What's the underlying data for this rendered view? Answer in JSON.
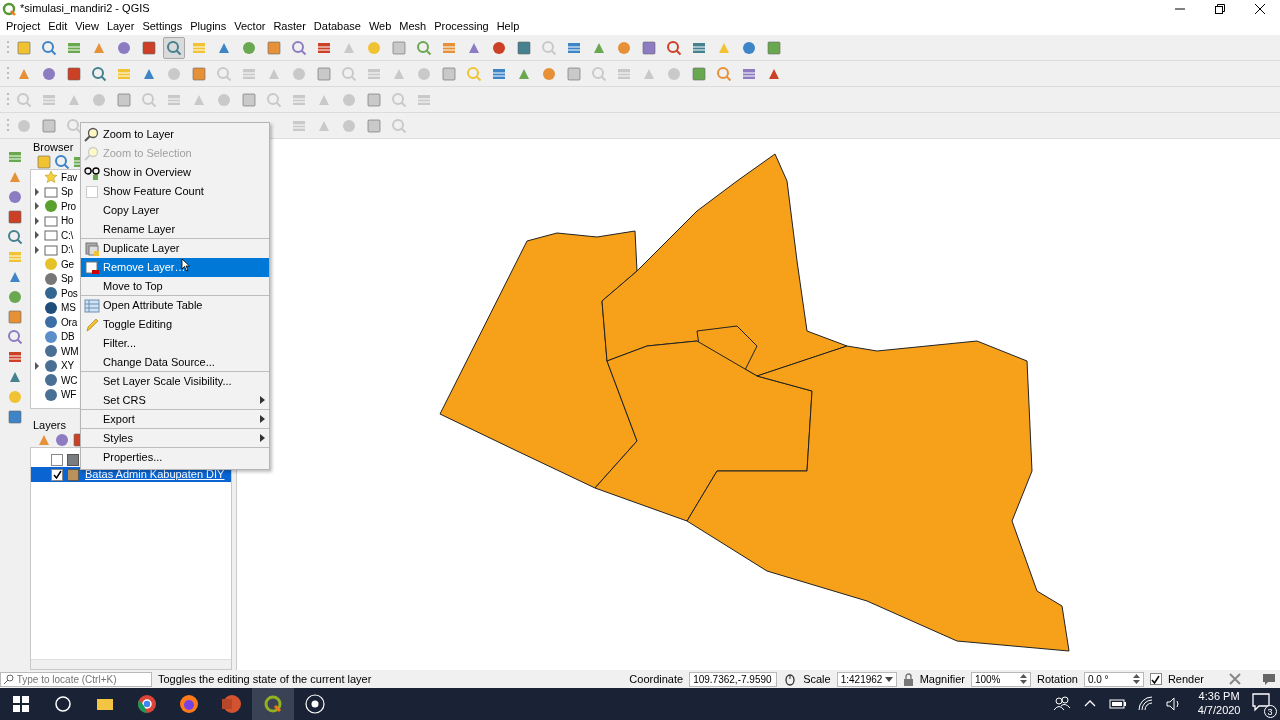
{
  "window": {
    "title": "*simulasi_mandiri2 - QGIS"
  },
  "menu_bar": [
    "Project",
    "Edit",
    "View",
    "Layer",
    "Settings",
    "Plugins",
    "Vector",
    "Raster",
    "Database",
    "Web",
    "Mesh",
    "Processing",
    "Help"
  ],
  "toolbars": [
    [
      {
        "disabled": false,
        "on": false
      },
      {
        "disabled": false,
        "on": false
      },
      {
        "disabled": false,
        "on": false
      },
      {
        "disabled": false,
        "on": false
      },
      {
        "disabled": false,
        "on": false
      },
      {
        "disabled": false,
        "on": false
      },
      {
        "disabled": false,
        "on": true
      },
      {
        "disabled": false,
        "on": false
      },
      {
        "disabled": false,
        "on": false
      },
      {
        "disabled": false,
        "on": false
      },
      {
        "disabled": false,
        "on": false
      },
      {
        "disabled": false,
        "on": false
      },
      {
        "disabled": false,
        "on": false
      },
      {
        "disabled": true,
        "on": false
      },
      {
        "disabled": false,
        "on": false
      },
      {
        "disabled": true,
        "on": false
      },
      {
        "disabled": false,
        "on": false
      },
      {
        "disabled": false,
        "on": false
      },
      {
        "disabled": false,
        "on": false
      },
      {
        "disabled": false,
        "on": false
      },
      {
        "disabled": false,
        "on": false
      },
      {
        "disabled": true,
        "on": false
      },
      {
        "disabled": false,
        "on": false
      },
      {
        "disabled": false,
        "on": false
      },
      {
        "disabled": false,
        "on": false
      },
      {
        "disabled": false,
        "on": false
      },
      {
        "disabled": false,
        "on": false
      },
      {
        "disabled": false,
        "on": false
      },
      {
        "disabled": false,
        "on": false
      },
      {
        "disabled": false,
        "on": false
      },
      {
        "disabled": false,
        "on": false
      }
    ],
    [
      {
        "disabled": false,
        "on": false
      },
      {
        "disabled": false,
        "on": false
      },
      {
        "disabled": false,
        "on": false
      },
      {
        "disabled": false,
        "on": false
      },
      {
        "disabled": false,
        "on": false
      },
      {
        "disabled": false,
        "on": false
      },
      {
        "disabled": true,
        "on": false
      },
      {
        "disabled": false,
        "on": false
      },
      {
        "disabled": true,
        "on": false
      },
      {
        "disabled": true,
        "on": false
      },
      {
        "disabled": true,
        "on": false
      },
      {
        "disabled": true,
        "on": false
      },
      {
        "disabled": true,
        "on": false
      },
      {
        "disabled": true,
        "on": false
      },
      {
        "disabled": true,
        "on": false
      },
      {
        "disabled": true,
        "on": false
      },
      {
        "disabled": true,
        "on": false
      },
      {
        "disabled": true,
        "on": false
      },
      {
        "disabled": false,
        "on": false
      },
      {
        "disabled": false,
        "on": false
      },
      {
        "disabled": false,
        "on": false
      },
      {
        "disabled": false,
        "on": false
      },
      {
        "disabled": true,
        "on": false
      },
      {
        "disabled": true,
        "on": false
      },
      {
        "disabled": true,
        "on": false
      },
      {
        "disabled": true,
        "on": false
      },
      {
        "disabled": true,
        "on": false
      },
      {
        "disabled": false,
        "on": false
      },
      {
        "disabled": false,
        "on": false
      },
      {
        "disabled": false,
        "on": false
      },
      {
        "disabled": false,
        "on": false
      }
    ],
    [
      {
        "disabled": true,
        "on": false
      },
      {
        "disabled": true,
        "on": false
      },
      {
        "disabled": true,
        "on": false
      },
      {
        "disabled": true,
        "on": false
      },
      {
        "disabled": true,
        "on": false
      },
      {
        "disabled": true,
        "on": false
      },
      {
        "disabled": true,
        "on": false
      },
      {
        "disabled": true,
        "on": false
      },
      {
        "disabled": true,
        "on": false
      },
      {
        "disabled": true,
        "on": false
      },
      {
        "disabled": true,
        "on": false
      },
      {
        "disabled": true,
        "on": false
      },
      {
        "disabled": true,
        "on": false
      },
      {
        "disabled": true,
        "on": false
      },
      {
        "disabled": true,
        "on": false
      },
      {
        "disabled": true,
        "on": false
      },
      {
        "disabled": true,
        "on": false
      }
    ],
    [
      {
        "disabled": true,
        "on": false
      },
      {
        "disabled": true,
        "on": false
      },
      {
        "disabled": true,
        "on": false
      },
      {
        "disabled": true,
        "on": false
      },
      {
        "disabled": true,
        "on": false
      },
      {
        "disabled": true,
        "on": false
      },
      {
        "disabled": true,
        "on": false
      },
      {
        "disabled": true,
        "on": false
      }
    ]
  ],
  "browser_panel": {
    "title": "Browser",
    "items": [
      {
        "label": "Fav",
        "expandable": false,
        "kind": "star"
      },
      {
        "label": "Sp",
        "expandable": true,
        "kind": "bookmark"
      },
      {
        "label": "Pro",
        "expandable": true,
        "kind": "project"
      },
      {
        "label": "Ho",
        "expandable": true,
        "kind": "home"
      },
      {
        "label": "C:\\",
        "expandable": true,
        "kind": "folder"
      },
      {
        "label": "D:\\",
        "expandable": true,
        "kind": "folder"
      },
      {
        "label": "Ge",
        "expandable": false,
        "kind": "package"
      },
      {
        "label": "Sp",
        "expandable": false,
        "kind": "feather"
      },
      {
        "label": "Pos",
        "expandable": false,
        "kind": "elephant"
      },
      {
        "label": "MS",
        "expandable": false,
        "kind": "fish"
      },
      {
        "label": "Ora",
        "expandable": false,
        "kind": "disc"
      },
      {
        "label": "DB",
        "expandable": false,
        "kind": "db2"
      },
      {
        "label": "WM",
        "expandable": false,
        "kind": "globe"
      },
      {
        "label": "XY",
        "expandable": true,
        "kind": "globe"
      },
      {
        "label": "WC",
        "expandable": false,
        "kind": "globe"
      },
      {
        "label": "WF",
        "expandable": false,
        "kind": "globe"
      }
    ]
  },
  "layers_panel": {
    "title": "Layers",
    "layers": [
      {
        "checked": false,
        "selected": false,
        "color": "#7a7d80"
      },
      {
        "label": "Batas Admin Kabupaten DIY",
        "checked": true,
        "selected": true,
        "color": "#b8925a"
      }
    ]
  },
  "context_menu": [
    {
      "label": "Zoom to Layer",
      "kind": "zoom",
      "disabled": false,
      "selected": false,
      "submenu": false,
      "separator_after": false
    },
    {
      "label": "Zoom to Selection",
      "kind": "zoom",
      "disabled": true,
      "selected": false,
      "submenu": false,
      "separator_after": false
    },
    {
      "label": "Show in Overview",
      "kind": "glasses",
      "disabled": false,
      "selected": false,
      "submenu": false,
      "separator_after": false
    },
    {
      "label": "Show Feature Count",
      "kind": "checkbox",
      "checked": false,
      "disabled": false,
      "selected": false,
      "submenu": false,
      "separator_after": false
    },
    {
      "label": "Copy Layer",
      "kind": "plain",
      "disabled": false,
      "selected": false,
      "submenu": false,
      "separator_after": false
    },
    {
      "label": "Rename Layer",
      "kind": "plain",
      "disabled": false,
      "selected": false,
      "submenu": false,
      "separator_after": true
    },
    {
      "label": "Duplicate Layer",
      "kind": "duplicate",
      "disabled": false,
      "selected": false,
      "submenu": false,
      "separator_after": false
    },
    {
      "label": "Remove Layer…",
      "kind": "remove",
      "disabled": false,
      "selected": true,
      "submenu": false,
      "separator_after": false
    },
    {
      "label": "Move to Top",
      "kind": "plain",
      "disabled": false,
      "selected": false,
      "submenu": false,
      "separator_after": true
    },
    {
      "label": "Open Attribute Table",
      "kind": "table",
      "disabled": false,
      "selected": false,
      "submenu": false,
      "separator_after": false
    },
    {
      "label": "Toggle Editing",
      "kind": "pencil",
      "disabled": false,
      "selected": false,
      "submenu": false,
      "separator_after": false
    },
    {
      "label": "Filter...",
      "kind": "plain",
      "disabled": false,
      "selected": false,
      "submenu": false,
      "separator_after": false
    },
    {
      "label": "Change Data Source...",
      "kind": "plain",
      "disabled": false,
      "selected": false,
      "submenu": false,
      "separator_after": true
    },
    {
      "label": "Set Layer Scale Visibility...",
      "kind": "plain",
      "disabled": false,
      "selected": false,
      "submenu": false,
      "separator_after": false
    },
    {
      "label": "Set CRS",
      "kind": "plain",
      "disabled": false,
      "selected": false,
      "submenu": true,
      "separator_after": true
    },
    {
      "label": "Export",
      "kind": "plain",
      "disabled": false,
      "selected": false,
      "submenu": true,
      "separator_after": true
    },
    {
      "label": "Styles",
      "kind": "plain",
      "disabled": false,
      "selected": false,
      "submenu": true,
      "separator_after": true
    },
    {
      "label": "Properties...",
      "kind": "plain",
      "disabled": false,
      "selected": false,
      "submenu": false,
      "separator_after": false
    }
  ],
  "status_bar": {
    "locator_placeholder": "Type to locate (Ctrl+K)",
    "message": "Toggles the editing state of the current layer",
    "coordinate_label": "Coordinate",
    "coordinate": "109.7362,-7.9590",
    "scale_label": "Scale",
    "scale": "1:421962",
    "magnifier_label": "Magnifier",
    "magnifier": "100%",
    "rotation_label": "Rotation",
    "rotation": "0.0 °",
    "render_label": "Render",
    "render": true
  },
  "taskbar": {
    "time": "4:36 PM",
    "date": "4/7/2020",
    "notifications": "3"
  }
}
